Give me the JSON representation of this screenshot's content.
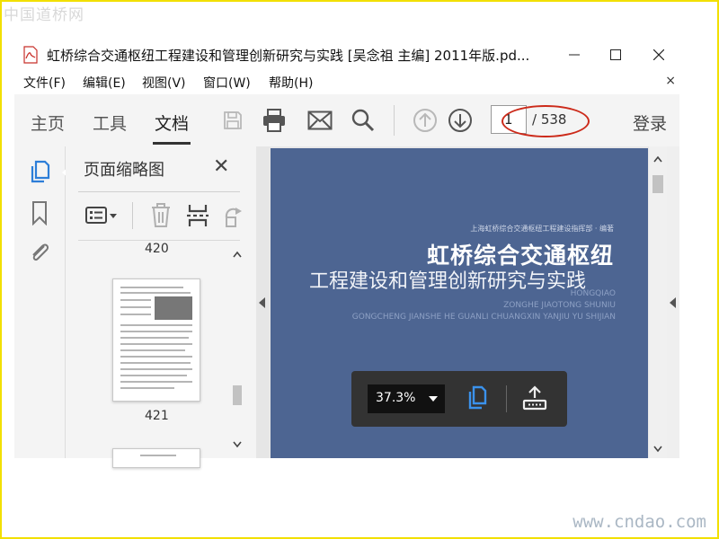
{
  "watermarks": {
    "top": "中国道桥网",
    "bottom": "www.cndao.com"
  },
  "window": {
    "title": "虹桥综合交通枢纽工程建设和管理创新研究与实践 [吴念祖 主编] 2011年版.pd...",
    "minimize_symbol": "—",
    "maximize_symbol": "☐",
    "close_symbol": "✕"
  },
  "menu": {
    "items": [
      "文件(F)",
      "编辑(E)",
      "视图(V)",
      "窗口(W)",
      "帮助(H)"
    ],
    "close_symbol": "×"
  },
  "toolbar": {
    "tabs": [
      "主页",
      "工具",
      "文档"
    ],
    "active_tab": "文档",
    "icons": [
      "save-icon",
      "print-icon",
      "email-icon",
      "search-icon",
      "page-up-icon",
      "page-down-icon"
    ],
    "page_current": "1",
    "page_total": "/ 538",
    "login_label": "登录",
    "annotation_color": "#cc2a1a"
  },
  "left_rail": {
    "icons": [
      "page-thumbnails-icon",
      "bookmark-icon",
      "attachment-icon"
    ],
    "accent": "#2d7ed8"
  },
  "thumbnail_panel": {
    "title": "页面缩略图",
    "close_symbol": "✕",
    "tools": [
      "options-menu-icon",
      "delete-icon",
      "extract-icon",
      "rotate-icon"
    ],
    "pages": [
      {
        "label": "420"
      },
      {
        "label": "421"
      }
    ]
  },
  "document": {
    "cover": {
      "publisher": "上海虹桥综合交通枢纽工程建设指挥部 · 编著",
      "title_line1": "虹桥综合交通枢纽",
      "title_line2": "工程建设和管理创新研究与实践",
      "pinyin_lines": [
        "HONGQIAO",
        "ZONGHE JIAOTONG SHUNIU",
        "GONGCHENG JIANSHE HE GUANLI CHUANGXIN YANJIU YU SHIJIAN"
      ],
      "background": "#4d6592"
    },
    "floating_bar": {
      "zoom": "37.3%",
      "icons": [
        "page-view-icon",
        "share-upload-icon"
      ]
    }
  }
}
